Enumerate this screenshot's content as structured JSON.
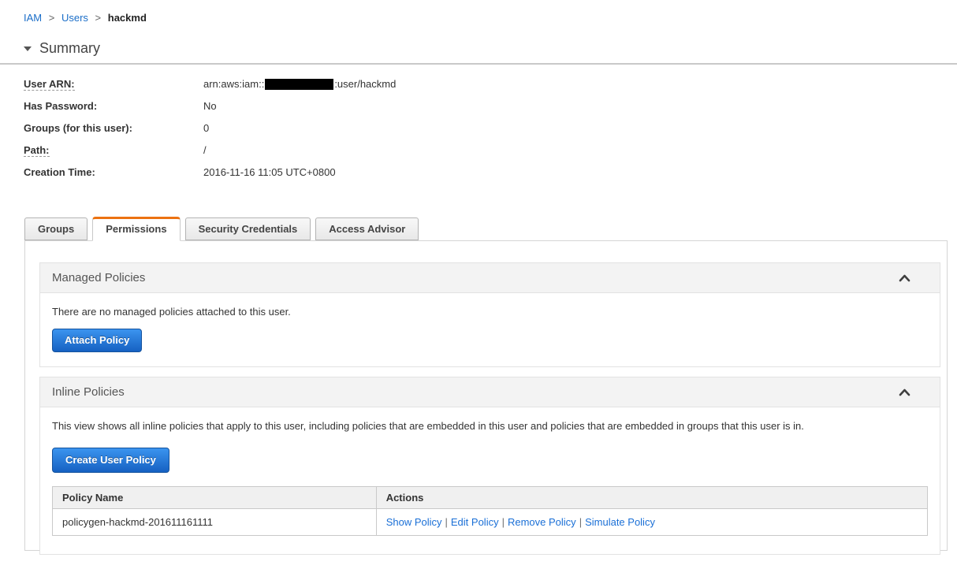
{
  "breadcrumb": {
    "separator": ">",
    "items": [
      {
        "label": "IAM"
      },
      {
        "label": "Users"
      },
      {
        "label": "hackmd"
      }
    ]
  },
  "summary": {
    "title": "Summary",
    "fields": {
      "user_arn": {
        "label": "User ARN:",
        "value_prefix": "arn:aws:iam::",
        "value_suffix": ":user/hackmd"
      },
      "has_password": {
        "label": "Has Password:",
        "value": "No"
      },
      "groups": {
        "label": "Groups (for this user):",
        "value": "0"
      },
      "path": {
        "label": "Path:",
        "value": "/"
      },
      "creation_time": {
        "label": "Creation Time:",
        "value": "2016-11-16 11:05 UTC+0800"
      }
    }
  },
  "tabs": [
    {
      "label": "Groups",
      "active": false
    },
    {
      "label": "Permissions",
      "active": true
    },
    {
      "label": "Security Credentials",
      "active": false
    },
    {
      "label": "Access Advisor",
      "active": false
    }
  ],
  "managed_policies": {
    "title": "Managed Policies",
    "empty_text": "There are no managed policies attached to this user.",
    "attach_button": "Attach Policy"
  },
  "inline_policies": {
    "title": "Inline Policies",
    "description": "This view shows all inline policies that apply to this user, including policies that are embedded in this user and policies that are embedded in groups that this user is in.",
    "create_button": "Create User Policy",
    "table": {
      "headers": [
        "Policy Name",
        "Actions"
      ],
      "actions_separator": "|",
      "rows": [
        {
          "policy_name": "policygen-hackmd-201611161111",
          "actions": [
            "Show Policy",
            "Edit Policy",
            "Remove Policy",
            "Simulate Policy"
          ]
        }
      ]
    }
  },
  "colors": {
    "tab_accent_orange": "#ec7211",
    "link_blue": "#1b6ec8",
    "button_blue_top": "#3b94ef",
    "button_blue_bottom": "#1661c2",
    "section_header_bg": "#f3f3f3"
  }
}
